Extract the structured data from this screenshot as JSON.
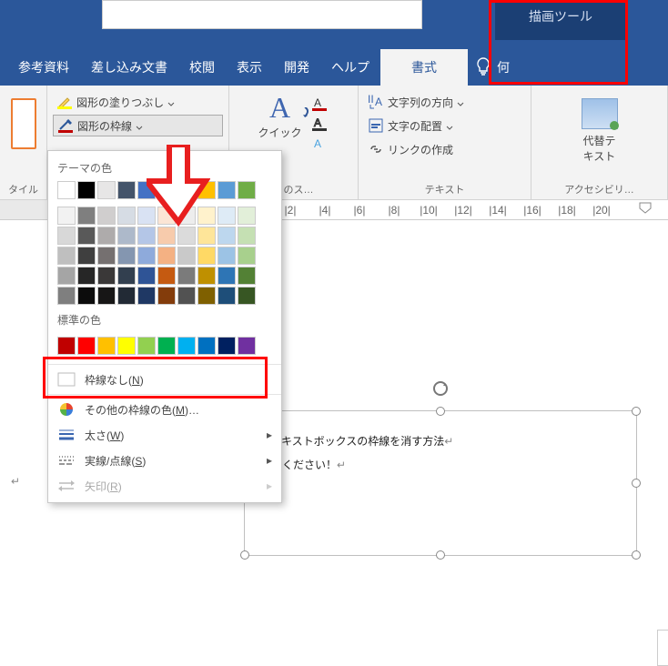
{
  "window": {
    "context_group": "描画ツール"
  },
  "tabs": {
    "items": [
      {
        "label": "参考資料"
      },
      {
        "label": "差し込み文書"
      },
      {
        "label": "校閲"
      },
      {
        "label": "表示"
      },
      {
        "label": "開発"
      },
      {
        "label": "ヘルプ"
      },
      {
        "label": "書式",
        "context": true,
        "active": true
      },
      {
        "label": "何"
      }
    ]
  },
  "ribbon": {
    "style_group_label": "タイル",
    "shape_fill": "図形の塗りつぶし",
    "shape_outline": "図形の枠線",
    "wordart_quick": "クイック",
    "wordart_group_label_frag": "トのス…",
    "text_dir": "文字列の方向",
    "text_align": "文字の配置",
    "create_link": "リンクの作成",
    "text_group_label": "テキスト",
    "alt_text": "代替テ\nキスト",
    "acc_group_label": "アクセシビリ…"
  },
  "ruler": {
    "numbers": [
      2,
      4,
      6,
      8,
      10,
      12,
      14,
      16,
      18,
      20
    ]
  },
  "popup": {
    "theme_title": "テーマの色",
    "standard_title": "標準の色",
    "no_outline": "枠線なし",
    "no_outline_key": "N",
    "more_colors": "その他の枠線の色",
    "more_colors_key": "M",
    "ellipsis": "…",
    "weight": "太さ",
    "weight_key": "W",
    "dashes": "実線/点線",
    "dashes_key": "S",
    "arrows": "矢印",
    "arrows_key": "R",
    "theme_top": [
      "#ffffff",
      "#000000",
      "#e7e6e6",
      "#44546a",
      "#4472c4",
      "#ed7d31",
      "#a5a5a5",
      "#ffc000",
      "#5b9bd5",
      "#70ad47"
    ],
    "theme_shades": [
      [
        "#f2f2f2",
        "#7f7f7f",
        "#d0cece",
        "#d6dce4",
        "#d9e2f3",
        "#fbe5d5",
        "#ededed",
        "#fff2cc",
        "#deebf6",
        "#e2efd9"
      ],
      [
        "#d8d8d8",
        "#595959",
        "#aeabab",
        "#adb9ca",
        "#b4c6e7",
        "#f7cbac",
        "#dbdbdb",
        "#fee599",
        "#bdd7ee",
        "#c5e0b3"
      ],
      [
        "#bfbfbf",
        "#3f3f3f",
        "#757070",
        "#8496b0",
        "#8eaadb",
        "#f4b183",
        "#c9c9c9",
        "#ffd965",
        "#9cc3e5",
        "#a8d08d"
      ],
      [
        "#a5a5a5",
        "#262626",
        "#3a3838",
        "#323f4f",
        "#2f5496",
        "#c55a11",
        "#7b7b7b",
        "#bf9000",
        "#2e75b5",
        "#538135"
      ],
      [
        "#7f7f7f",
        "#0c0c0c",
        "#171616",
        "#222a35",
        "#1f3864",
        "#833c0b",
        "#525252",
        "#7f6000",
        "#1e4e79",
        "#375623"
      ]
    ],
    "standard": [
      "#c00000",
      "#ff0000",
      "#ffc000",
      "#ffff00",
      "#92d050",
      "#00b050",
      "#00b0f0",
      "#0070c0",
      "#002060",
      "#7030a0"
    ]
  },
  "doc": {
    "line1_frag": "d でテキストボックスの枠線を消す方法",
    "line2_frag": "教えてください！"
  }
}
